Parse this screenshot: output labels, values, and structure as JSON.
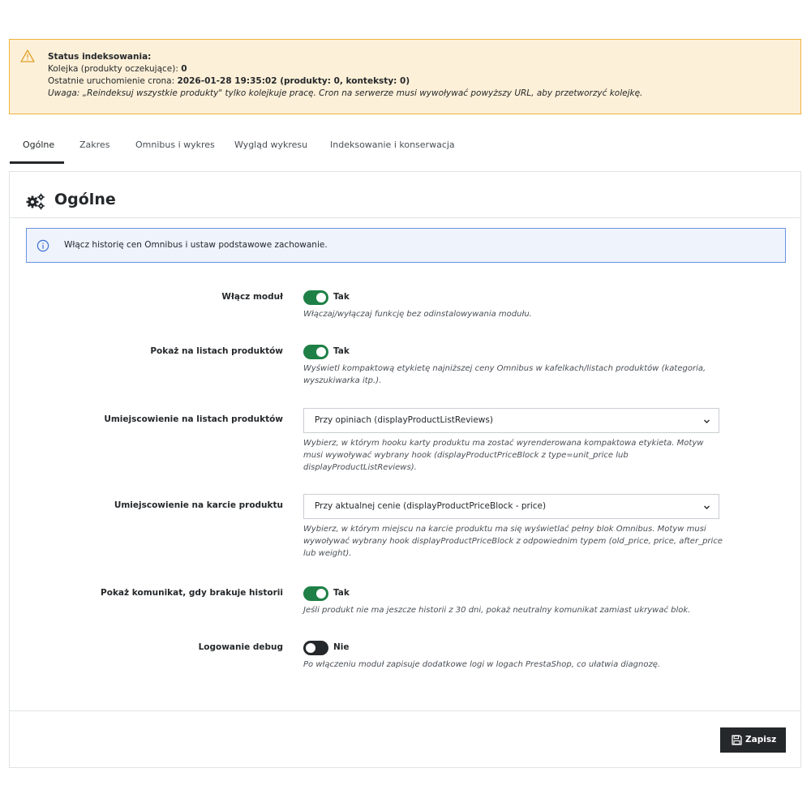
{
  "status": {
    "title": "Status indeksowania:",
    "queue_label": "Kolejka (produkty oczekujące): ",
    "queue_value": "0",
    "cron_label": "Ostatnie uruchomienie crona: ",
    "cron_value": "2026-01-28 19:35:02 (produkty: 0, konteksty: 0)",
    "note_prefix": "Uwaga:",
    "note_text": " „Reindeksuj wszystkie produkty\" tylko kolejkuje pracę. Cron na serwerze musi wywoływać powyższy URL, aby przetworzyć kolejkę."
  },
  "tabs": [
    {
      "label": "Ogólne",
      "active": true
    },
    {
      "label": "Zakres",
      "active": false
    },
    {
      "label": "Omnibus i wykres",
      "active": false
    },
    {
      "label": "Wygląd wykresu",
      "active": false
    },
    {
      "label": "Indeksowanie i konserwacja",
      "active": false
    }
  ],
  "panel": {
    "title": "Ogólne",
    "title_icon": "cogs-icon",
    "info_icon": "info-circle-icon",
    "info_text": "Włącz historię cen Omnibus i ustaw podstawowe zachowanie."
  },
  "fields": {
    "enable_module": {
      "label": "Włącz moduł",
      "value": "Tak",
      "enabled": true,
      "help": "Włączaj/wyłączaj funkcję bez odinstalowywania modułu."
    },
    "show_on_lists": {
      "label": "Pokaż na listach produktów",
      "value": "Tak",
      "enabled": true,
      "help": "Wyświetl kompaktową etykietę najniższej ceny Omnibus w kafelkach/listach produktów (kategoria, wyszukiwarka itp.)."
    },
    "list_position": {
      "label": "Umiejscowienie na listach produktów",
      "selected": "Przy opiniach (displayProductListReviews)",
      "help": "Wybierz, w którym hooku karty produktu ma zostać wyrenderowana kompaktowa etykieta. Motyw musi wywoływać wybrany hook (displayProductPriceBlock z type=unit_price lub displayProductListReviews)."
    },
    "product_position": {
      "label": "Umiejscowienie na karcie produktu",
      "selected": "Przy aktualnej cenie (displayProductPriceBlock - price)",
      "help": "Wybierz, w którym miejscu na karcie produktu ma się wyświetlać pełny blok Omnibus. Motyw musi wywoływać wybrany hook displayProductPriceBlock z odpowiednim typem (old_price, price, after_price lub weight)."
    },
    "missing_history": {
      "label": "Pokaż komunikat, gdy brakuje historii",
      "value": "Tak",
      "enabled": true,
      "help": "Jeśli produkt nie ma jeszcze historii z 30 dni, pokaż neutralny komunikat zamiast ukrywać blok."
    },
    "debug_logging": {
      "label": "Logowanie debug",
      "value": "Nie",
      "enabled": false,
      "help": "Po włączeniu moduł zapisuje dodatkowe logi w logach PrestaShop, co ułatwia diagnozę."
    }
  },
  "footer": {
    "save_label": "Zapisz",
    "save_icon": "floppy-disk-icon"
  },
  "colors": {
    "warning_bg": "#fdf0d8",
    "warning_border": "#efb23b",
    "info_bg": "#eef3fc",
    "info_border": "#6a93e0",
    "toggle_on": "#1e8046",
    "toggle_off": "#25282b",
    "primary_dark": "#25282b"
  }
}
